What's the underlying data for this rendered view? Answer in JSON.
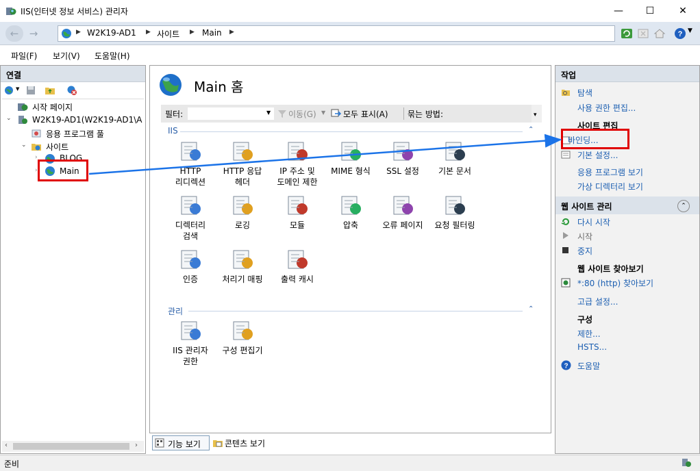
{
  "window": {
    "title": "IIS(인터넷 정보 서비스) 관리자",
    "minimize": "—",
    "maximize": "☐",
    "close": "✕"
  },
  "address": {
    "crumbs": [
      "W2K19-AD1",
      "사이트",
      "Main"
    ]
  },
  "menu": [
    "파일(F)",
    "보기(V)",
    "도움말(H)"
  ],
  "connections": {
    "header": "연결",
    "tree": {
      "start_page": "시작 페이지",
      "server": "W2K19-AD1(W2K19-AD1\\A",
      "app_pools": "응용 프로그램 풀",
      "sites": "사이트",
      "blog": "BLOG",
      "main": "Main"
    }
  },
  "center": {
    "title": "Main 홈",
    "filter_label": "필터:",
    "go_label": "이동(G)",
    "show_all_label": "모두 표시(A)",
    "group_by_label": "묶는 방법:",
    "group_iis": "IIS",
    "group_manage": "관리",
    "iis_features": [
      [
        "HTTP",
        "리디렉션"
      ],
      [
        "HTTP 응답",
        "헤더"
      ],
      [
        "IP 주소 및",
        "도메인 제한"
      ],
      [
        "MIME 형식"
      ],
      [
        "SSL 설정"
      ],
      [
        "기본 문서"
      ],
      [
        "디렉터리",
        "검색"
      ],
      [
        "로깅"
      ],
      [
        "모듈"
      ],
      [
        "압축"
      ],
      [
        "오류 페이지"
      ],
      [
        "요청 필터링"
      ],
      [
        "인증"
      ],
      [
        "처리기 매핑"
      ],
      [
        "출력 캐시"
      ]
    ],
    "manage_features": [
      [
        "IIS 관리자",
        "권한"
      ],
      [
        "구성 편집기"
      ]
    ],
    "tab_features": "기능 보기",
    "tab_content": "콘텐츠 보기"
  },
  "actions": {
    "header": "작업",
    "explore": "탐색",
    "edit_permissions": "사용 권한 편집...",
    "edit_site_head": "사이트 편집",
    "bindings": "바인딩...",
    "basic_settings": "기본 설정...",
    "view_apps": "응용 프로그램 보기",
    "view_vdirs": "가상 디렉터리 보기",
    "manage_site_head": "웹 사이트 관리",
    "restart": "다시 시작",
    "start": "시작",
    "stop": "중지",
    "browse_head": "웹 사이트 찾아보기",
    "browse_80": "*:80 (http) 찾아보기",
    "advanced": "고급 설정...",
    "config_head": "구성",
    "limits": "제한...",
    "hsts": "HSTS...",
    "help": "도움말"
  },
  "status": {
    "text": "준비"
  },
  "colors": {
    "link": "#1c5fb1",
    "highlight_box": "#e00000",
    "arrow": "#1b73e8"
  }
}
